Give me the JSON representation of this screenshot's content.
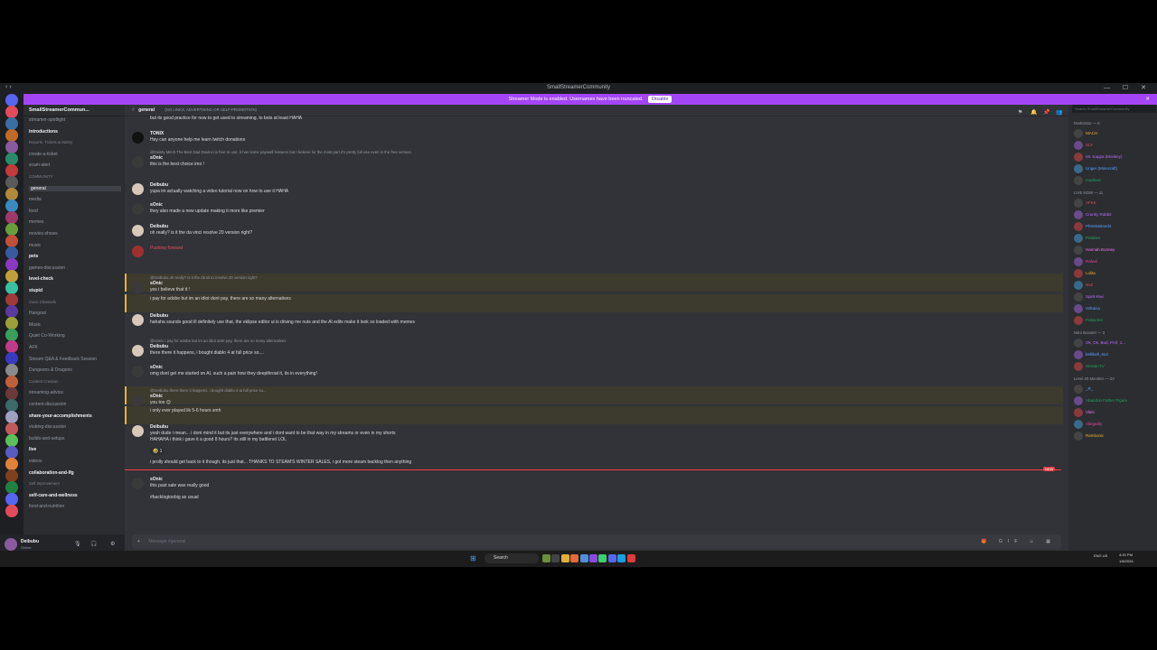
{
  "window": {
    "title": "SmallStreamerCommunity",
    "controls": [
      "—",
      "☐",
      "✕"
    ]
  },
  "banner": {
    "text": "Streamer Mode is enabled. Usernames have been truncated.",
    "button": "Disable"
  },
  "server": {
    "name": "SmallStreamerCommun..."
  },
  "channels": [
    {
      "label": "streamer-spotlight",
      "kind": "text"
    },
    {
      "label": "introductions",
      "kind": "bold"
    },
    {
      "label": "Reports, Tickets & Safety",
      "kind": "cat"
    },
    {
      "label": "create-a-ticket",
      "kind": "text"
    },
    {
      "label": "scam-alert",
      "kind": "text"
    },
    {
      "label": "COMMUNITY",
      "kind": "cat"
    },
    {
      "label": "general",
      "kind": "sel"
    },
    {
      "label": "media",
      "kind": "text"
    },
    {
      "label": "food",
      "kind": "text"
    },
    {
      "label": "memes",
      "kind": "text"
    },
    {
      "label": "movies-shows",
      "kind": "text"
    },
    {
      "label": "music",
      "kind": "text"
    },
    {
      "label": "pets",
      "kind": "bold"
    },
    {
      "label": "games-discussion",
      "kind": "text"
    },
    {
      "label": "level-check",
      "kind": "bold"
    },
    {
      "label": "stupid",
      "kind": "bold"
    },
    {
      "label": "Voice Channels",
      "kind": "cat"
    },
    {
      "label": "Hangout",
      "kind": "text"
    },
    {
      "label": "Music",
      "kind": "text"
    },
    {
      "label": "Quiet Co-Working",
      "kind": "text"
    },
    {
      "label": "AFK",
      "kind": "text"
    },
    {
      "label": "Stream Q&A & Feedback Session",
      "kind": "text"
    },
    {
      "label": "Dungeons & Dragons",
      "kind": "text"
    },
    {
      "label": "Content Creation",
      "kind": "cat"
    },
    {
      "label": "streaming-advice",
      "kind": "text"
    },
    {
      "label": "content-discussion",
      "kind": "text"
    },
    {
      "label": "share-your-accomplishments",
      "kind": "bold"
    },
    {
      "label": "vtubing-discussion",
      "kind": "text"
    },
    {
      "label": "builds-and-setups",
      "kind": "text"
    },
    {
      "label": "live",
      "kind": "bold"
    },
    {
      "label": "videos",
      "kind": "text"
    },
    {
      "label": "collaboration-and-lfg",
      "kind": "bold"
    },
    {
      "label": "Self Improvement",
      "kind": "cat"
    },
    {
      "label": "self-care-and-wellness",
      "kind": "bold"
    },
    {
      "label": "food-and-nutrition",
      "kind": "text"
    }
  ],
  "channel_header": {
    "name": "general",
    "topic": "(NO LINKS, ADVERTISING OR SELF-PROMOTION)",
    "search_placeholder": "Search SmallStreamerCommunity"
  },
  "messages": [
    {
      "name": "",
      "reply": "",
      "text": "but its good practice for now to get used to streaming, to bots at least HAHA",
      "color": "#f2f3f5"
    },
    {
      "name": "TONIX",
      "reply": "",
      "text": "Hey can anyone help me learn twitch donations",
      "color": "#f2f3f5"
    },
    {
      "name": "sOnic",
      "reply": "@Dainty Mitch The Best Dad  Davinci is free to use, it has some paywall features but I believe for the most part it's pretty full use even in the free version",
      "text": "this is the best choice imo !",
      "color": "#f2f3f5"
    },
    {
      "name": "Deibubu",
      "reply": "",
      "text": "yupa im actually watching a video tutorial now on how to use it HAHA",
      "color": "#f2f3f5"
    },
    {
      "name": "sOnic",
      "reply": "",
      "text": "they also made a new update making it more like premier",
      "color": "#f2f3f5"
    },
    {
      "name": "Deibubu",
      "reply": "",
      "text": "oh really? is it the da vinci resolve 20 version right?",
      "color": "#f2f3f5"
    },
    {
      "name": "Pushing forward",
      "reply": "",
      "text": "Pushing forward",
      "color": "#e34b5c"
    },
    {
      "name": "sOnic",
      "reply": "@Deibubu oh really? is it the da vinci resolve 20 version right?",
      "text": "yes i believe that it !",
      "color": "#f2f3f5"
    },
    {
      "name": "",
      "reply": "",
      "text": "i pay for adobe but im an idiot dont pay, there are so many alternatives",
      "color": "#f2f3f5"
    },
    {
      "name": "Deibubu",
      "reply": "",
      "text": "hahaha sounds good ill definitely use that, the eklipse editor ui is driving me nuts and the AI edits make it look so loaded with memes",
      "color": "#f2f3f5"
    },
    {
      "name": "Deibubu",
      "reply": "@sOnic i pay for adobe but im an idiot dont pay, there are so many alternatives",
      "text": "there there it happens, i bought diablo 4 at full price so....",
      "color": "#f2f3f5"
    },
    {
      "name": "sOnic",
      "reply": "",
      "text": "omg dont get me started on AI, such a pain how they deepthroat it, its in everything!",
      "color": "#f2f3f5"
    },
    {
      "name": "sOnic",
      "reply": "@Deibubu there there it happens, i bought diablo 4 at full price so...",
      "text": "you too 😊",
      "color": "#f2f3f5"
    },
    {
      "name": "",
      "reply": "",
      "text": "i only ever played lik 5-6 hours smh",
      "color": "#f2f3f5"
    },
    {
      "name": "Deibubu",
      "reply": "",
      "text": "yeah dude i mean... i dont mind it but its just everywhere and i dont want to be that way in my streams or even in my shorts",
      "color": "#f2f3f5"
    },
    {
      "name": "",
      "reply": "",
      "text": "HAHAHA i think i gave it a good 8 hours? its still in my battlenet LOL",
      "color": "#f2f3f5"
    },
    {
      "name": "",
      "reply": "",
      "text": "i prolly should get back to it though, its just that... THANKS TO STEAM'S WINTER SALES, i got more steam backlog then anything",
      "color": "#f2f3f5"
    },
    {
      "name": "sOnic",
      "reply": "",
      "text": "this past sale was really good",
      "color": "#f2f3f5"
    },
    {
      "name": "",
      "reply": "",
      "text": "#backlogtoobig as usual",
      "color": "#f2f3f5"
    }
  ],
  "reaction": "🤣 1",
  "new_marker": "NEW",
  "composer": {
    "placeholder": "Message #general"
  },
  "user": {
    "name": "Deibubu",
    "status": "Online"
  },
  "members": {
    "sections": [
      {
        "title": "Moderator — 5",
        "names": [
          "MACH",
          "SLY",
          "Mr. Kappa (Monkey)",
          "Unger (Minecraft)",
          "madtoez"
        ]
      },
      {
        "title": "LIVE NOW — 11",
        "names": [
          "AFKK",
          "Cranky Rabbit",
          "PheebsBandit",
          "Pebbles",
          "Hannah Bonney",
          "Rafael",
          "Lolita",
          "NvZ",
          "Spirit Kiwi",
          "Voltaica",
          "Pubacher"
        ]
      },
      {
        "title": "Nitro Booster — 3",
        "names": [
          "Ok, Ok, Bud, Prof, 1...",
          "bellibell_6x3",
          "SinisterTV"
        ]
      },
      {
        "title": "Level 20 Member — 23",
        "names": [
          "_R_",
          "Abandon Father Figure",
          "Vitim",
          "Allegedly",
          "Rambonic"
        ]
      }
    ]
  },
  "taskbar": {
    "search": "Search",
    "time": "4:20 PM",
    "date": "1/8/2026",
    "lang": "ENG US"
  }
}
